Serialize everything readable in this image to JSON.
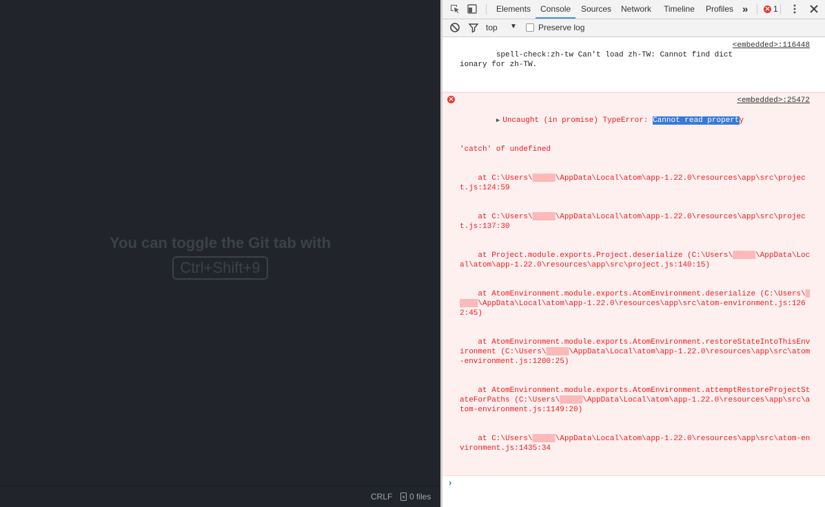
{
  "editor": {
    "hint_text": "You can toggle the Git tab with",
    "hint_shortcut": "Ctrl+Shift+9",
    "status": {
      "line_ending": "CRLF",
      "files": "0 files"
    }
  },
  "devtools": {
    "tabs": [
      {
        "label": "Elements",
        "active": false
      },
      {
        "label": "Console",
        "active": true
      },
      {
        "label": "Sources",
        "active": false
      },
      {
        "label": "Network",
        "active": false
      },
      {
        "label": "Timeline",
        "active": false
      },
      {
        "label": "Profiles",
        "active": false
      }
    ],
    "more_tabs": "»",
    "error_count": "1",
    "context": "top",
    "preserve_log_label": "Preserve log",
    "preserve_log_checked": false,
    "messages": [
      {
        "type": "log",
        "text": "spell-check:zh-tw Can't load zh-TW: Cannot find dictionary for zh-TW.",
        "source": "<embedded>:116448"
      },
      {
        "type": "error",
        "prefix": "Uncaught (in promise) TypeError: ",
        "highlight": "Cannot read propert",
        "rest_first": "y",
        "continuation": "'catch' of undefined",
        "source": "<embedded>:25472",
        "stack": [
          "    at C:\\Users\\▒▒▒▒▒\\AppData\\Local\\atom\\app-1.22.0\\resources\\app\\src\\project.js:124:59",
          "    at C:\\Users\\▒▒▒▒▒\\AppData\\Local\\atom\\app-1.22.0\\resources\\app\\src\\project.js:137:30",
          "    at Project.module.exports.Project.deserialize (C:\\Users\\▒▒▒▒▒\\AppData\\Local\\atom\\app-1.22.0\\resources\\app\\src\\project.js:140:15)",
          "    at AtomEnvironment.module.exports.AtomEnvironment.deserialize (C:\\Users\\▒▒▒▒▒\\AppData\\Local\\atom\\app-1.22.0\\resources\\app\\src\\atom-environment.js:1262:45)",
          "    at AtomEnvironment.module.exports.AtomEnvironment.restoreStateIntoThisEnvironment (C:\\Users\\▒▒▒▒▒\\AppData\\Local\\atom\\app-1.22.0\\resources\\app\\src\\atom-environment.js:1200:25)",
          "    at AtomEnvironment.module.exports.AtomEnvironment.attemptRestoreProjectStateForPaths (C:\\Users\\▒▒▒▒▒\\AppData\\Local\\atom\\app-1.22.0\\resources\\app\\src\\atom-environment.js:1149:20)",
          "    at C:\\Users\\▒▒▒▒▒\\AppData\\Local\\atom\\app-1.22.0\\resources\\app\\src\\atom-environment.js:1435:34"
        ]
      }
    ],
    "prompt_symbol": "›"
  },
  "colors": {
    "editor_bg": "#21252b",
    "hint_text": "#3b414b",
    "error_text": "#f01a1a",
    "error_bg": "#fff0f0",
    "active_tab_underline": "#4a90e2",
    "selection": "#3879d9"
  },
  "icons": [
    "inspect-element-icon",
    "device-mode-icon",
    "clear-console-icon",
    "filter-icon",
    "more-vert-icon",
    "close-icon",
    "error-icon",
    "file-icon"
  ]
}
